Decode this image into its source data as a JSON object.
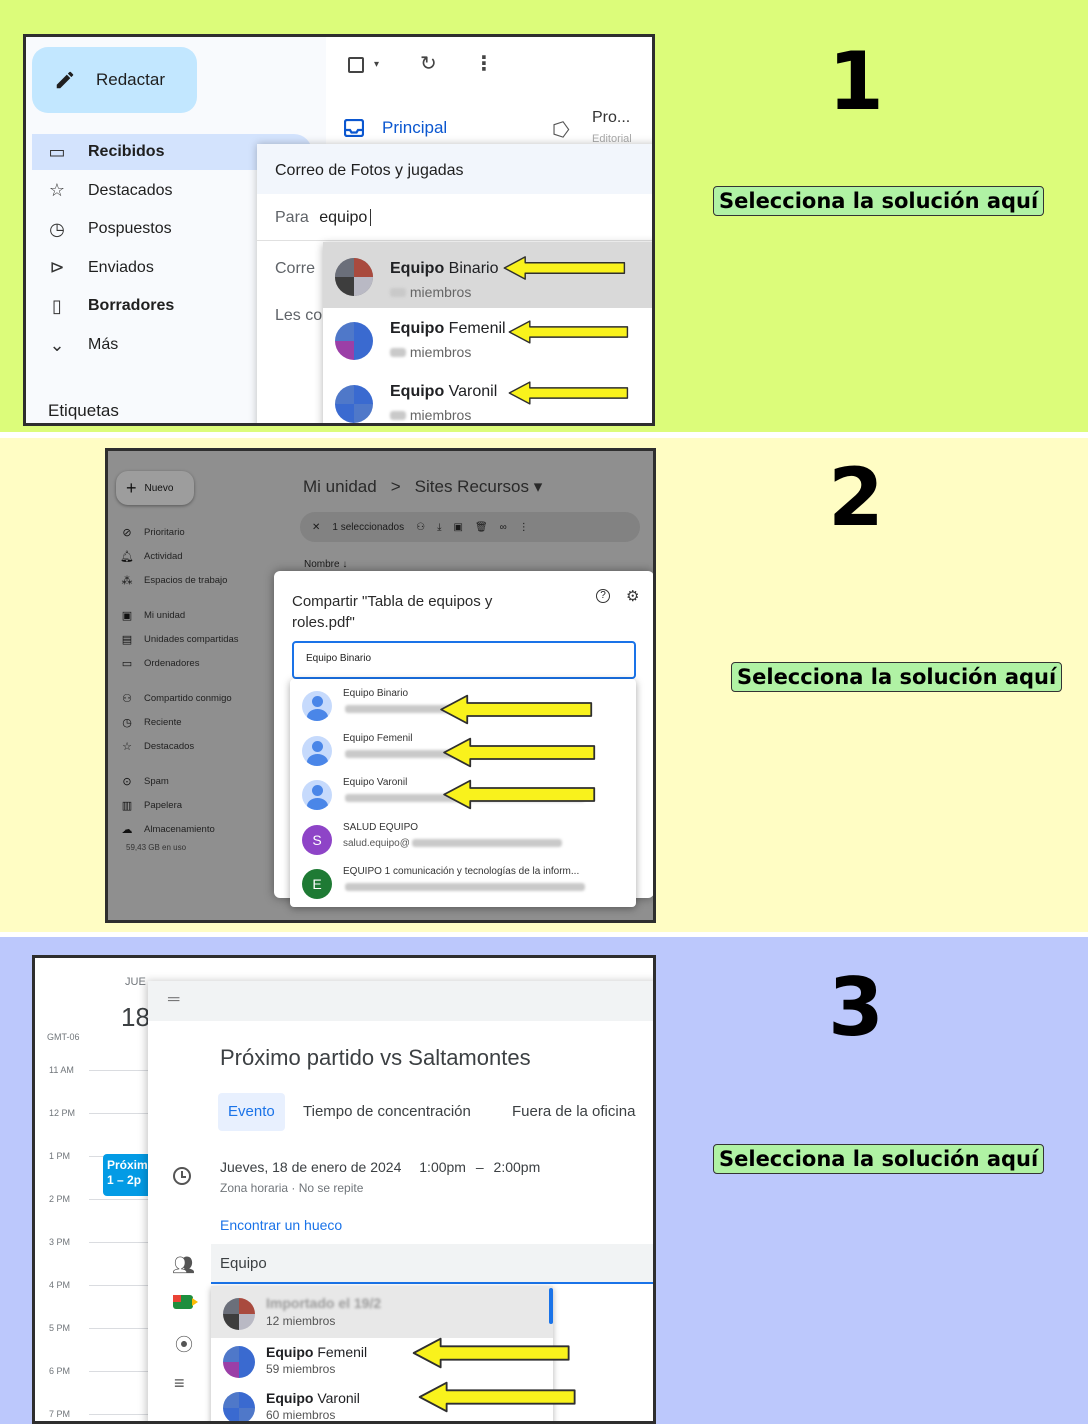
{
  "instruction_label": "Selecciona la solución aquí",
  "panel1": {
    "number": "1",
    "compose_label": "Redactar",
    "nav": [
      {
        "label": "Recibidos",
        "icon": "inbox-icon",
        "bold": true
      },
      {
        "label": "Destacados",
        "icon": "star-icon",
        "bold": false
      },
      {
        "label": "Pospuestos",
        "icon": "clock-icon",
        "bold": false
      },
      {
        "label": "Enviados",
        "icon": "send-icon",
        "bold": false
      },
      {
        "label": "Borradores",
        "icon": "draft-icon",
        "bold": true
      },
      {
        "label": "Más",
        "icon": "chevron-down-icon",
        "bold": false
      }
    ],
    "labels_heading": "Etiquetas",
    "tab_principal": "Principal",
    "tab_promo": "Pro...",
    "tab_promo_sub": "Editorial",
    "compose_title": "Correo de Fotos y jugadas",
    "to_label": "Para",
    "to_value": "equipo",
    "row_correo": "Corre",
    "row_les": "Les co",
    "suggestions": [
      {
        "name_bold": "Equipo",
        "name_rest": " Binario",
        "sub": "miembros"
      },
      {
        "name_bold": "Equipo",
        "name_rest": " Femenil",
        "sub": "miembros"
      },
      {
        "name_bold": "Equipo",
        "name_rest": " Varonil",
        "sub": "miembros"
      }
    ],
    "colors": {
      "compose_bg": "#c2e7ff",
      "selected_bg": "#d3e3fd",
      "accent": "#0b57d0"
    }
  },
  "panel2": {
    "number": "2",
    "new_label": "Nuevo",
    "nav": [
      {
        "label": "Prioritario",
        "icon": "check-circle-icon"
      },
      {
        "label": "Actividad",
        "icon": "bell-icon"
      },
      {
        "label": "Espacios de trabajo",
        "icon": "workspace-icon"
      },
      {
        "label": "Mi unidad",
        "icon": "drive-icon"
      },
      {
        "label": "Unidades compartidas",
        "icon": "shared-drive-icon"
      },
      {
        "label": "Ordenadores",
        "icon": "computer-icon"
      },
      {
        "label": "Compartido conmigo",
        "icon": "people-icon"
      },
      {
        "label": "Reciente",
        "icon": "clock-icon"
      },
      {
        "label": "Destacados",
        "icon": "star-icon"
      },
      {
        "label": "Spam",
        "icon": "spam-icon"
      },
      {
        "label": "Papelera",
        "icon": "trash-icon"
      },
      {
        "label": "Almacenamiento",
        "icon": "cloud-icon"
      }
    ],
    "storage": "59,43 GB en uso",
    "breadcrumb_root": "Mi unidad",
    "breadcrumb_sep": ">",
    "breadcrumb_folder": "Sites Recursos",
    "selected_count": "1 seleccionados",
    "column_name": "Nombre",
    "dialog_title": "Compartir \"Tabla de equipos y roles.pdf\"",
    "search_value": "Equipo Binario",
    "results": [
      {
        "name": "Equipo Binario",
        "sub": "",
        "avatar": "person",
        "color": "#4a86e8"
      },
      {
        "name": "Equipo Femenil",
        "sub": "",
        "avatar": "person",
        "color": "#4a86e8"
      },
      {
        "name": "Equipo Varonil",
        "sub": "",
        "avatar": "person",
        "color": "#4a86e8"
      },
      {
        "name": "SALUD EQUIPO",
        "sub": "salud.equipo@",
        "avatar": "S",
        "color": "#8e44c7"
      },
      {
        "name": "EQUIPO 1 comunicación y tecnologías de la inform...",
        "sub": "",
        "avatar": "E",
        "color": "#1e7a34"
      }
    ]
  },
  "panel3": {
    "number": "3",
    "day_label": "JUE",
    "day_number": "18",
    "timezone": "GMT-06",
    "hours": [
      "11 AM",
      "12 PM",
      "1 PM",
      "2 PM",
      "3 PM",
      "4 PM",
      "5 PM",
      "6 PM",
      "7 PM"
    ],
    "event_chip_title": "Próxim",
    "event_chip_time": "1 – 2p",
    "event_title": "Próximo partido vs Saltamontes",
    "tabs": [
      "Evento",
      "Tiempo de concentración",
      "Fuera de la oficina"
    ],
    "date_text": "Jueves, 18 de enero de 2024",
    "time_start": "1:00pm",
    "time_dash": "–",
    "time_end": "2:00pm",
    "tz_repeat": "Zona horaria · No se repite",
    "find_slot": "Encontrar un hueco",
    "guest_input": "Equipo",
    "guests": [
      {
        "name_bold": "Importado el 19/2",
        "name_rest": "",
        "sub": "12 miembros",
        "blurred": true
      },
      {
        "name_bold": "Equipo",
        "name_rest": " Femenil",
        "sub": "59 miembros",
        "blurred": false
      },
      {
        "name_bold": "Equipo",
        "name_rest": " Varonil",
        "sub": "60 miembros",
        "blurred": false
      }
    ],
    "colors": {
      "event_chip": "#039be5",
      "tab_bg": "#e8f0fe",
      "accent": "#1a73e8"
    }
  }
}
